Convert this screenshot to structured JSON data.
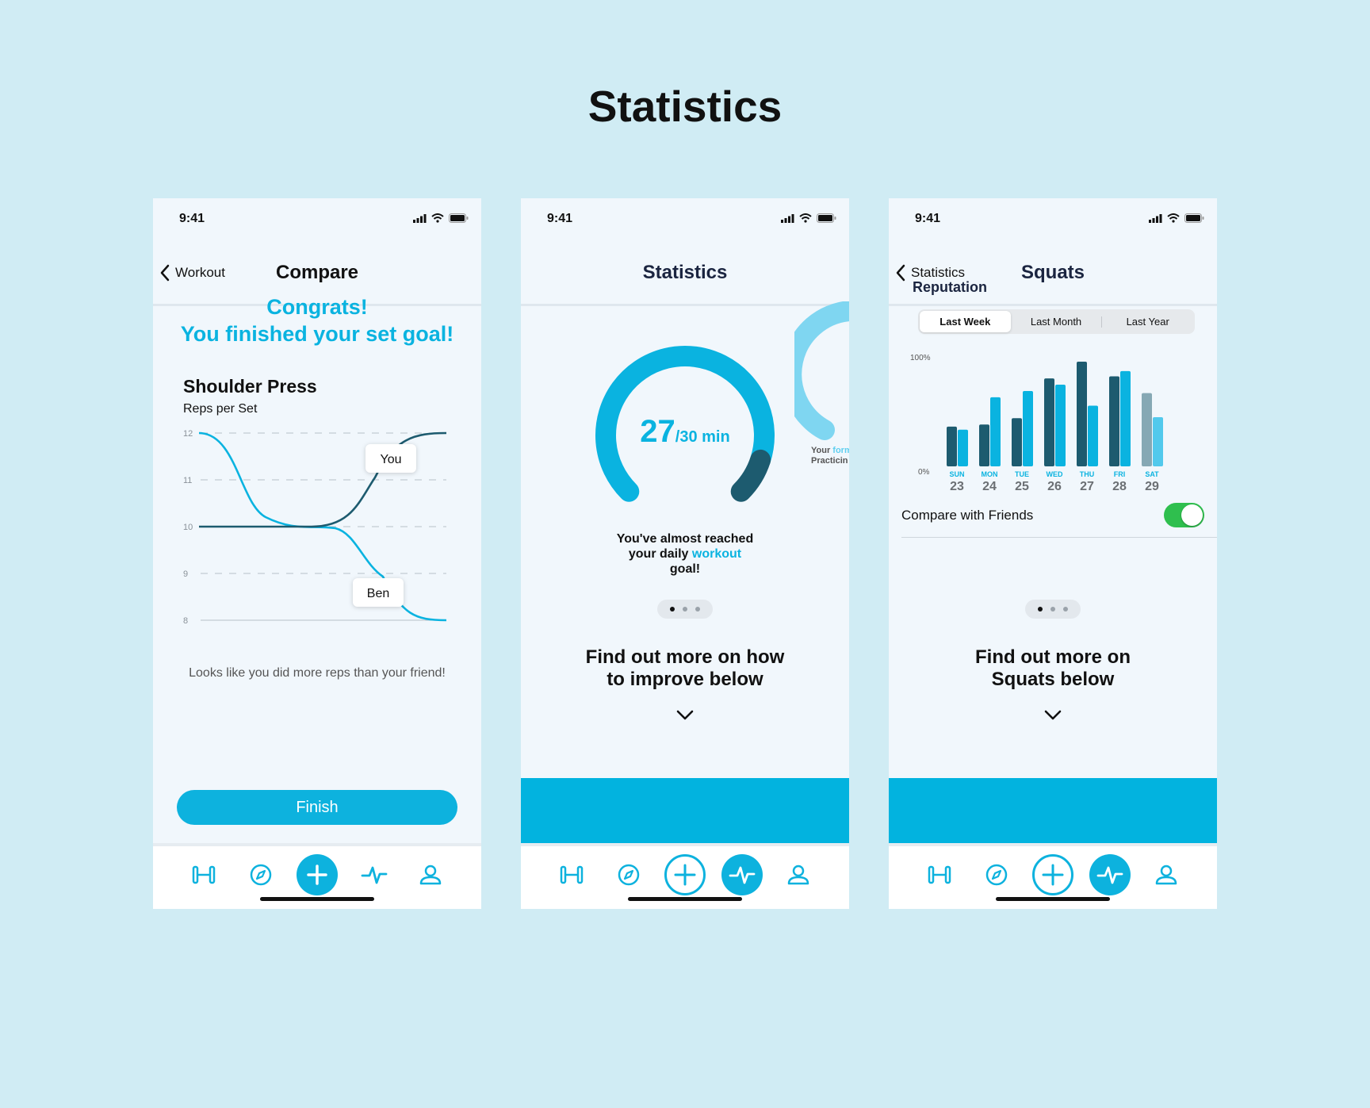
{
  "page_title": "Statistics",
  "status": {
    "time": "9:41"
  },
  "phone1": {
    "back_label": "Workout",
    "title": "Compare",
    "congrats_line1": "Congrats!",
    "congrats_line2": "You finished your set goal!",
    "exercise": "Shoulder Press",
    "subtitle": "Reps per Set",
    "note": "Looks like you did more reps than your friend!",
    "finish": "Finish",
    "chart_data": {
      "type": "line",
      "y_ticks": [
        "12",
        "11",
        "10",
        "9",
        "8"
      ],
      "ylim": [
        8,
        12
      ],
      "series": [
        {
          "name": "You",
          "values": [
            10,
            10,
            10,
            12
          ]
        },
        {
          "name": "Ben",
          "values": [
            12,
            10,
            10,
            8
          ]
        }
      ],
      "grid": true
    }
  },
  "phone2": {
    "title": "Statistics",
    "gauge_value": "27",
    "gauge_unit": "/30 min",
    "gauge_fraction": 0.9,
    "goal_line1": "You've almost reached",
    "goal_line2a": "your daily ",
    "goal_line2b": "workout",
    "goal_line3": "goal!",
    "ghost_line1a": "Your ",
    "ghost_line1b": "form",
    "ghost_line2": "Practicin",
    "more_line1": "Find out more on how",
    "more_line2": "to improve below"
  },
  "phone3": {
    "back_label": "Statistics",
    "title": "Squats",
    "section": "Reputation",
    "segments": [
      "Last Week",
      "Last Month",
      "Last Year"
    ],
    "selected_segment": "Last Week",
    "toggle_label": "Compare with Friends",
    "toggle_on": true,
    "more_line1": "Find out more on",
    "more_line2": "Squats below",
    "chart_data": {
      "type": "bar",
      "y_ticks": [
        "100%",
        "0%"
      ],
      "ylim": [
        0,
        100
      ],
      "categories": [
        {
          "day": "SUN",
          "date": "23"
        },
        {
          "day": "MON",
          "date": "24"
        },
        {
          "day": "TUE",
          "date": "25"
        },
        {
          "day": "WED",
          "date": "26"
        },
        {
          "day": "THU",
          "date": "27"
        },
        {
          "day": "FRI",
          "date": "28"
        },
        {
          "day": "SAT",
          "date": "29"
        }
      ],
      "series": [
        {
          "values": [
            38,
            40,
            46,
            84,
            100,
            86,
            70
          ]
        },
        {
          "values": [
            35,
            66,
            72,
            78,
            58,
            91,
            47
          ]
        }
      ],
      "colors": [
        "#1d5b6f",
        "#0ab3e0"
      ]
    }
  },
  "colors": {
    "accent": "#0db2de",
    "dark": "#1d5b6f",
    "background": "#d0ecf4",
    "toggle": "#2fbf4e"
  },
  "tabbar_icons": [
    "dumbbell-icon",
    "compass-icon",
    "plus-icon",
    "activity-icon",
    "profile-icon"
  ]
}
